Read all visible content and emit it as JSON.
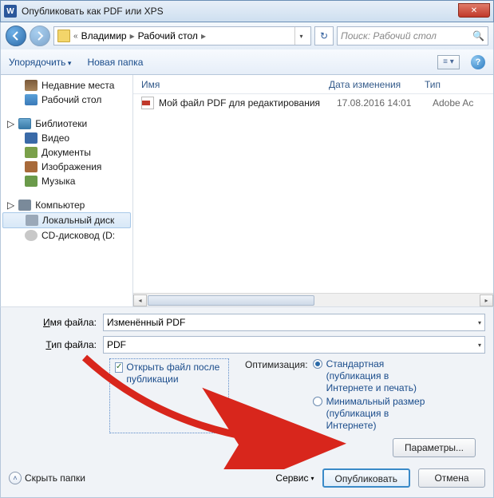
{
  "title": "Опубликовать как PDF или XPS",
  "breadcrumb": {
    "seg1": "Владимир",
    "seg2": "Рабочий стол"
  },
  "search": {
    "placeholder": "Поиск: Рабочий стол"
  },
  "toolbar": {
    "organize": "Упорядочить",
    "newfolder": "Новая папка"
  },
  "tree": {
    "recent": "Недавние места",
    "desktop": "Рабочий стол",
    "libraries": "Библиотеки",
    "video": "Видео",
    "documents": "Документы",
    "images": "Изображения",
    "music": "Музыка",
    "computer": "Компьютер",
    "localdisk": "Локальный диск",
    "cddrive": "CD-дисковод (D:"
  },
  "columns": {
    "name": "Имя",
    "date": "Дата изменения",
    "type": "Тип"
  },
  "files": {
    "row0": {
      "name": "Мой файл PDF для редактирования",
      "date": "17.08.2016 14:01",
      "type": "Adobe Ac"
    }
  },
  "filename_label": "Имя файла:",
  "filetype_label": "Тип файла:",
  "filename_value": "Изменённый PDF",
  "filetype_value": "PDF",
  "open_after": "Открыть файл после публикации",
  "optimization": {
    "label": "Оптимизация:",
    "standard": "Стандартная (публикация в Интернете и печать)",
    "minimal": "Минимальный размер (публикация в Интернете)"
  },
  "params_btn": "Параметры...",
  "hide_folders": "Скрыть папки",
  "service": "Сервис",
  "publish": "Опубликовать",
  "cancel": "Отмена"
}
